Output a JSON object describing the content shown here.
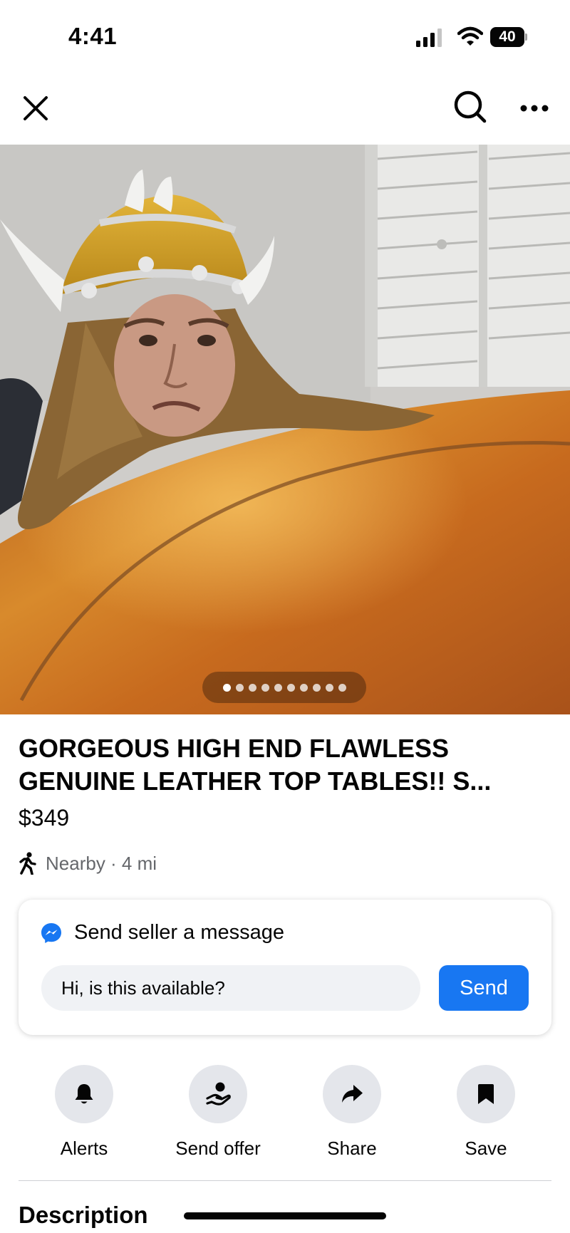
{
  "status_bar": {
    "time": "4:41",
    "battery": "40"
  },
  "nav": {
    "close_icon": "close-icon",
    "search_icon": "search-icon",
    "more_icon": "more-icon"
  },
  "photo": {
    "description": "listing-photo",
    "carousel": {
      "total": 10,
      "active_index": 0
    }
  },
  "listing": {
    "title": "GORGEOUS HIGH END FLAWLESS GENUINE LEATHER TOP TABLES!! S...",
    "price": "$349",
    "location": "Nearby · 4 mi"
  },
  "message": {
    "heading": "Send seller a message",
    "input_value": "Hi, is this available?",
    "send_label": "Send",
    "accent": "#1877f2"
  },
  "actions": [
    {
      "label": "Alerts",
      "icon": "bell-icon"
    },
    {
      "label": "Send offer",
      "icon": "offer-icon"
    },
    {
      "label": "Share",
      "icon": "share-icon"
    },
    {
      "label": "Save",
      "icon": "bookmark-icon"
    }
  ],
  "description": {
    "heading": "Description"
  }
}
